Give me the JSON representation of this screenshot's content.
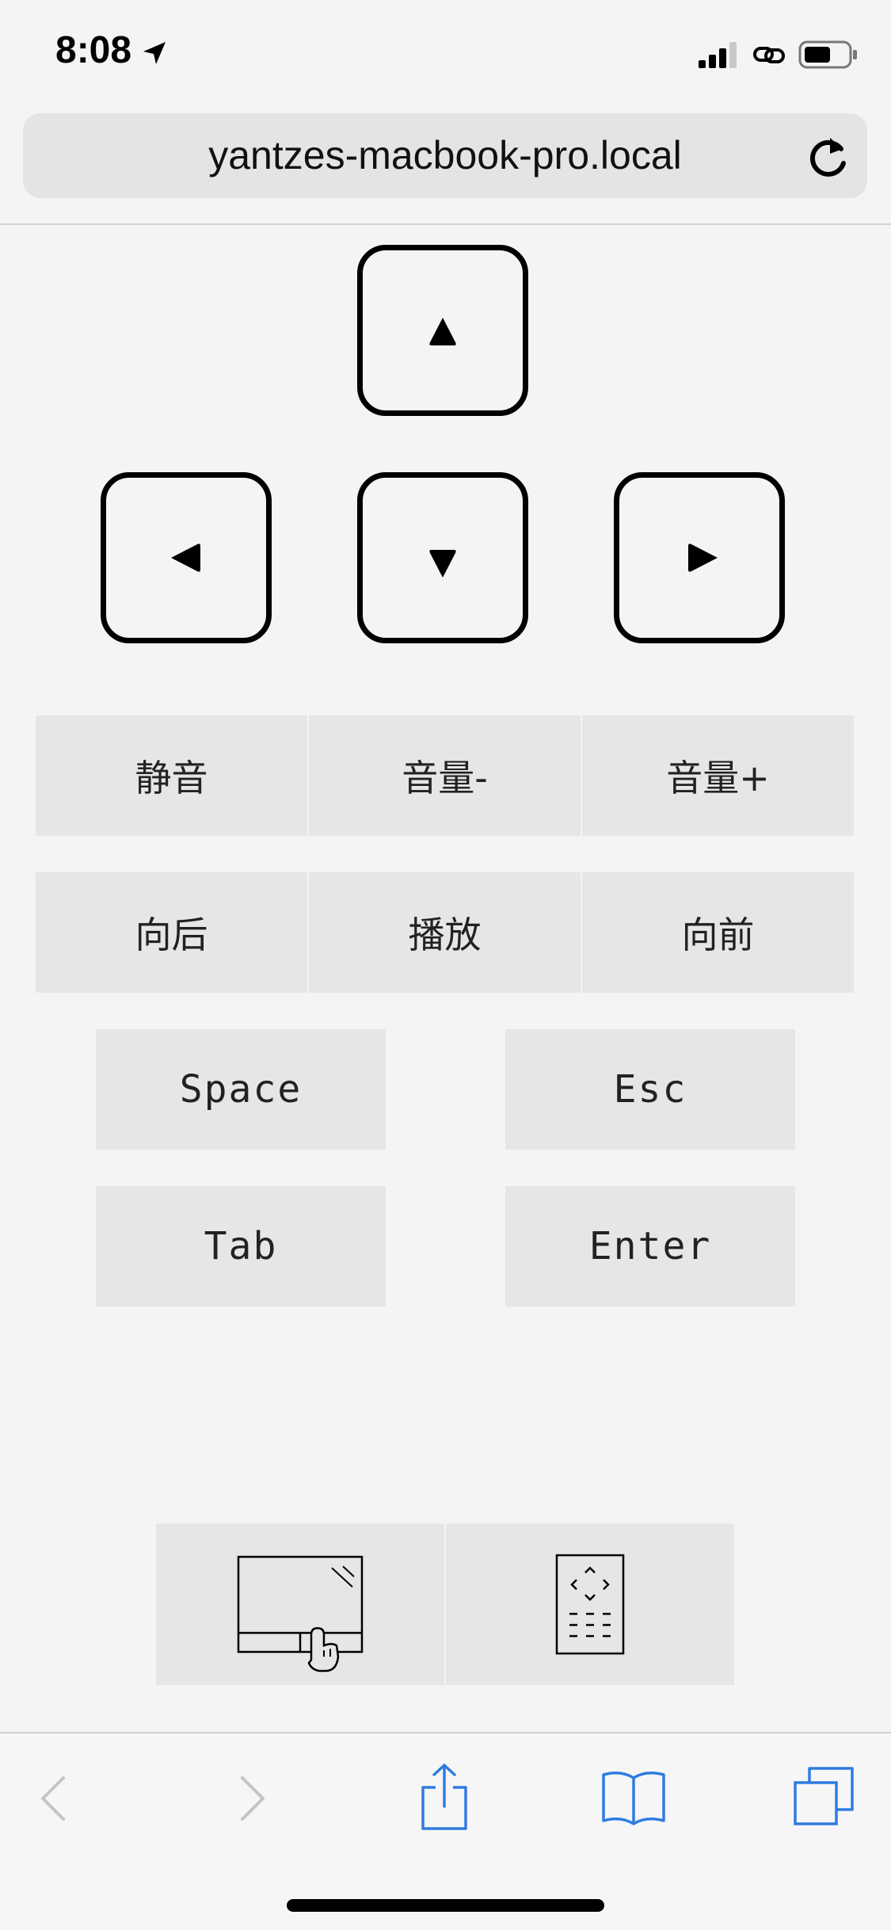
{
  "status_bar": {
    "time": "8:08",
    "icons": [
      "location-arrow-icon",
      "signal-icon",
      "hotspot-icon",
      "battery-icon"
    ]
  },
  "browser": {
    "url": "yantzes-macbook-pro.local",
    "reload_icon": "reload-icon"
  },
  "arrow_keys": {
    "up": "arrow-up-icon",
    "left": "arrow-left-icon",
    "down": "arrow-down-icon",
    "right": "arrow-right-icon"
  },
  "media_row": {
    "mute": "静音",
    "volume_down": "音量-",
    "volume_up": "音量+"
  },
  "playback_row": {
    "back": "向后",
    "play": "播放",
    "forward": "向前"
  },
  "keys": {
    "space": "Space",
    "esc": "Esc",
    "tab": "Tab",
    "enter": "Enter"
  },
  "mode_switcher": {
    "items": [
      "trackpad-mode-icon",
      "remote-mode-icon"
    ]
  },
  "toolbar": {
    "items": [
      "back-icon",
      "forward-icon",
      "share-icon",
      "bookmarks-icon",
      "tabs-icon"
    ],
    "accent_color": "#2f7ce0",
    "disabled_color": "#c4c4c8"
  }
}
